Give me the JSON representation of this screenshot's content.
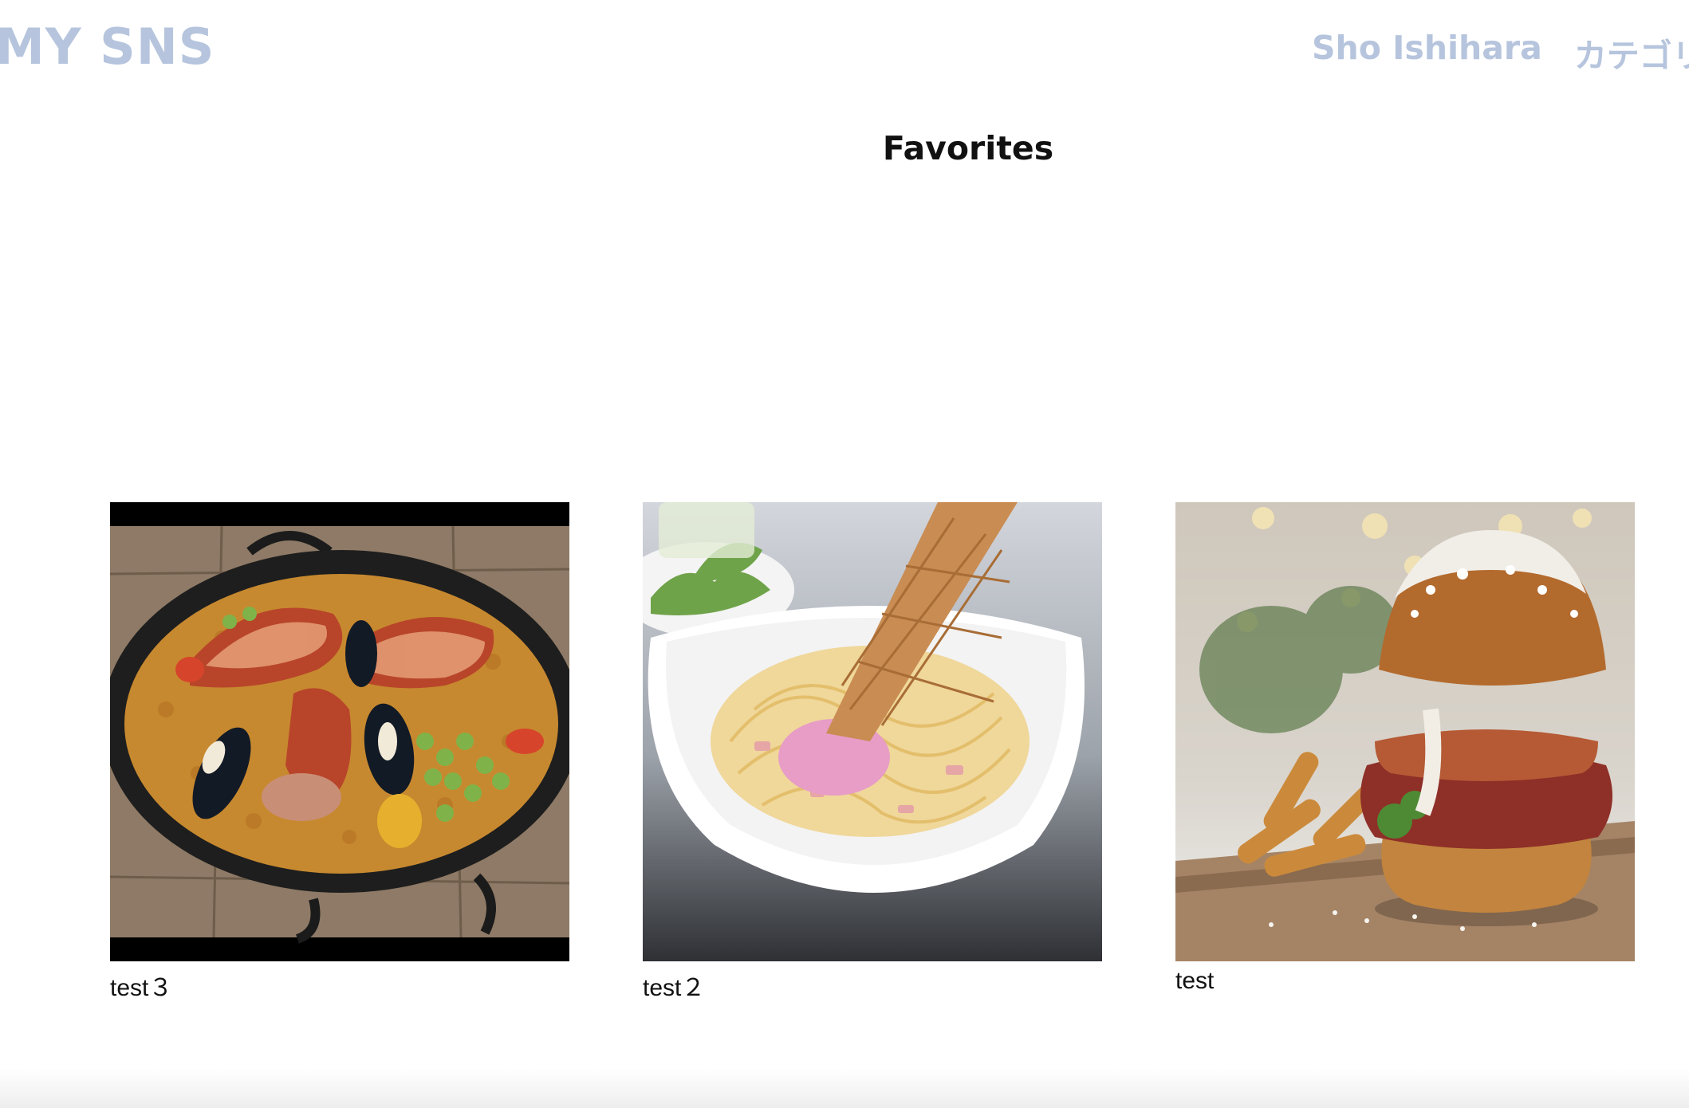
{
  "header": {
    "brand": "MY SNS",
    "nav": {
      "user_name": "Sho Ishihara",
      "category": "カテゴリ"
    }
  },
  "main": {
    "title": "Favorites",
    "posts": [
      {
        "caption": "test３",
        "image": "seafood-paella-photo"
      },
      {
        "caption": "test２",
        "image": "carbonara-with-ice-cream-cone-photo"
      },
      {
        "caption": "test",
        "image": "burger-and-fries-photo"
      }
    ]
  },
  "colors": {
    "nav_text": "#b6c5dd",
    "title_text": "#111111",
    "background": "#ffffff"
  }
}
